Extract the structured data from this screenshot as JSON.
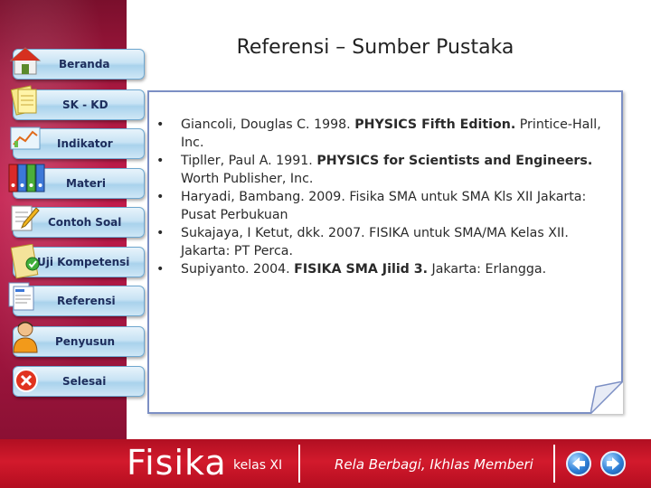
{
  "slide": {
    "title": "Referensi – Sumber Pustaka"
  },
  "sidebar": {
    "items": [
      {
        "label": "Beranda",
        "icon": "home-icon"
      },
      {
        "label": "SK - KD",
        "icon": "notes-icon"
      },
      {
        "label": "Indikator",
        "icon": "chart-board-icon"
      },
      {
        "label": "Materi",
        "icon": "binders-icon"
      },
      {
        "label": "Contoh Soal",
        "icon": "paper-pencil-icon"
      },
      {
        "label": "Uji Kompetensi",
        "icon": "check-icon"
      },
      {
        "label": "Referensi",
        "icon": "document-stack-icon"
      },
      {
        "label": "Penyusun",
        "icon": "person-icon"
      },
      {
        "label": "Selesai",
        "icon": "close-icon"
      }
    ]
  },
  "references": [
    {
      "pre": "Giancoli, Douglas C. 1998. ",
      "bold": "PHYSICS Fifth Edition.",
      "post": " Printice-Hall, Inc."
    },
    {
      "pre": "Tipller, Paul A. 1991. ",
      "bold": "PHYSICS for Scientists and Engineers.",
      "post": " Worth Publisher, Inc."
    },
    {
      "pre": "Haryadi, Bambang. 2009. Fisika SMA untuk SMA Kls XII Jakarta: Pusat Perbukuan",
      "bold": "",
      "post": ""
    },
    {
      "pre": "Sukajaya, I Ketut, dkk. 2007. FISIKA untuk SMA/MA Kelas XII. Jakarta: PT Perca.",
      "bold": "",
      "post": ""
    },
    {
      "pre": "Supiyanto. 2004. ",
      "bold": "FISIKA SMA Jilid 3.",
      "post": " Jakarta: Erlangga."
    }
  ],
  "footer": {
    "brand": "Fisika",
    "class_label": "kelas XI",
    "motto": "Rela Berbagi, Ikhlas Memberi",
    "prev_icon": "arrow-left-icon",
    "next_icon": "arrow-right-icon"
  },
  "colors": {
    "sidebar": "#b0193f",
    "footer": "#c4141f",
    "button": "#c8e3f4",
    "box_border": "#7c8fc4"
  }
}
